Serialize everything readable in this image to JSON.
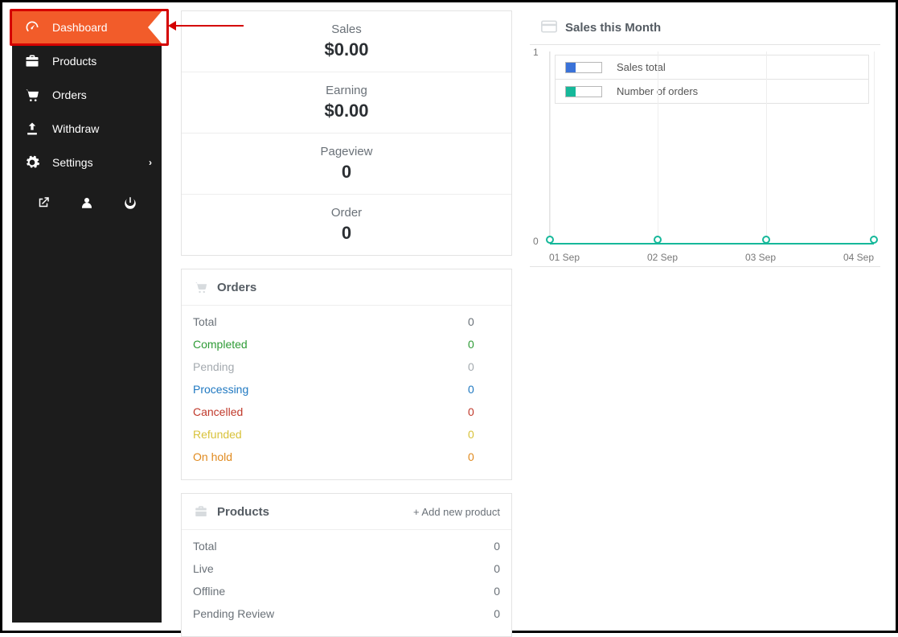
{
  "sidebar": {
    "items": [
      {
        "label": "Dashboard"
      },
      {
        "label": "Products"
      },
      {
        "label": "Orders"
      },
      {
        "label": "Withdraw"
      },
      {
        "label": "Settings"
      }
    ]
  },
  "stats": {
    "sales_label": "Sales",
    "sales_value": "$0.00",
    "earning_label": "Earning",
    "earning_value": "$0.00",
    "pageview_label": "Pageview",
    "pageview_value": "0",
    "order_label": "Order",
    "order_value": "0"
  },
  "orders": {
    "title": "Orders",
    "rows": {
      "total_label": "Total",
      "total_value": "0",
      "completed_label": "Completed",
      "completed_value": "0",
      "pending_label": "Pending",
      "pending_value": "0",
      "processing_label": "Processing",
      "processing_value": "0",
      "cancelled_label": "Cancelled",
      "cancelled_value": "0",
      "refunded_label": "Refunded",
      "refunded_value": "0",
      "onhold_label": "On hold",
      "onhold_value": "0"
    }
  },
  "products": {
    "title": "Products",
    "add_label": "+ Add new product",
    "rows": {
      "total_label": "Total",
      "total_value": "0",
      "live_label": "Live",
      "live_value": "0",
      "offline_label": "Offline",
      "offline_value": "0",
      "pending_label": "Pending Review",
      "pending_value": "0"
    }
  },
  "chart": {
    "title": "Sales this Month",
    "legend": {
      "a": "Sales total",
      "b": "Number of orders"
    },
    "colors": {
      "a": "#3a72d8",
      "b": "#16b89a"
    },
    "y_ticks": {
      "top": "1",
      "bottom": "0"
    },
    "x_ticks": [
      "01 Sep",
      "02 Sep",
      "03 Sep",
      "04 Sep"
    ]
  },
  "chart_data": {
    "type": "line",
    "title": "Sales this Month",
    "xlabel": "",
    "ylabel": "",
    "ylim": [
      0,
      1
    ],
    "x": [
      "01 Sep",
      "02 Sep",
      "03 Sep",
      "04 Sep"
    ],
    "series": [
      {
        "name": "Sales total",
        "color": "#3a72d8",
        "values": [
          0,
          0,
          0,
          0
        ]
      },
      {
        "name": "Number of orders",
        "color": "#16b89a",
        "values": [
          0,
          0,
          0,
          0
        ]
      }
    ]
  }
}
